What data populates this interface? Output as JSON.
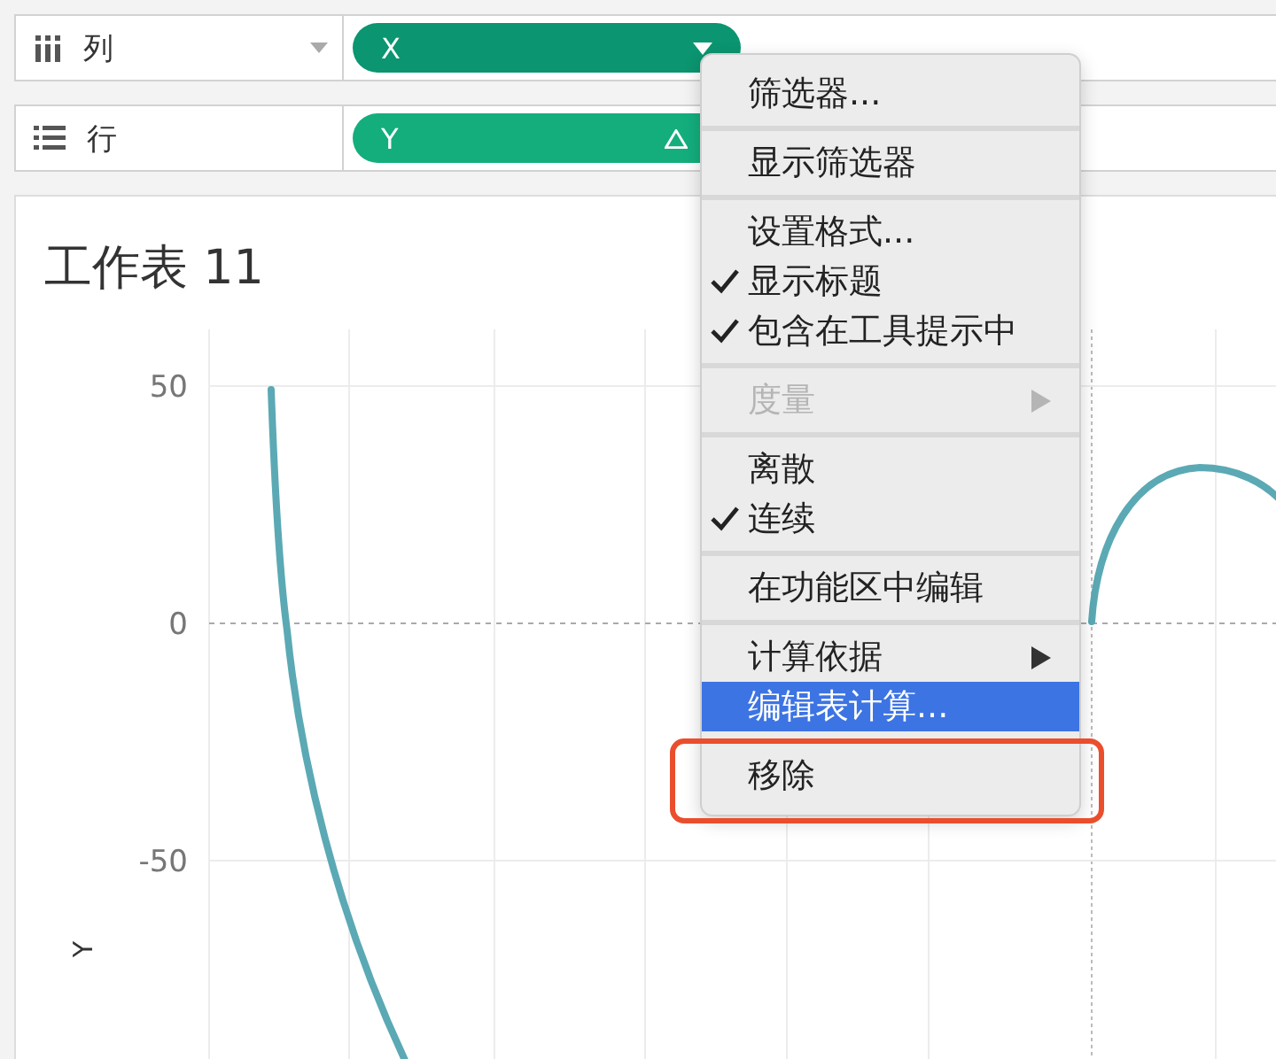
{
  "shelves": [
    {
      "kind": "columns",
      "label": "列",
      "pill": "X"
    },
    {
      "kind": "rows",
      "label": "行",
      "pill": "Y"
    }
  ],
  "sheet": {
    "title": "工作表 11",
    "y_axis": {
      "label": "Y",
      "ticks": [
        "50",
        "0",
        "-50"
      ]
    }
  },
  "context_menu": {
    "groups": [
      {
        "items": [
          {
            "label": "筛选器...",
            "checked": false,
            "disabled": false,
            "submenu": false,
            "selected": false
          }
        ]
      },
      {
        "items": [
          {
            "label": "显示筛选器",
            "checked": false,
            "disabled": false,
            "submenu": false,
            "selected": false
          }
        ]
      },
      {
        "items": [
          {
            "label": "设置格式...",
            "checked": false,
            "disabled": false,
            "submenu": false,
            "selected": false
          },
          {
            "label": "显示标题",
            "checked": true,
            "disabled": false,
            "submenu": false,
            "selected": false
          },
          {
            "label": "包含在工具提示中",
            "checked": true,
            "disabled": false,
            "submenu": false,
            "selected": false
          }
        ]
      },
      {
        "items": [
          {
            "label": "度量",
            "checked": false,
            "disabled": true,
            "submenu": true,
            "selected": false
          }
        ]
      },
      {
        "items": [
          {
            "label": "离散",
            "checked": false,
            "disabled": false,
            "submenu": false,
            "selected": false
          },
          {
            "label": "连续",
            "checked": true,
            "disabled": false,
            "submenu": false,
            "selected": false
          }
        ]
      },
      {
        "items": [
          {
            "label": "在功能区中编辑",
            "checked": false,
            "disabled": false,
            "submenu": false,
            "selected": false
          }
        ]
      },
      {
        "items": [
          {
            "label": "计算依据",
            "checked": false,
            "disabled": false,
            "submenu": true,
            "selected": false
          },
          {
            "label": "编辑表计算...",
            "checked": false,
            "disabled": false,
            "submenu": false,
            "selected": true
          }
        ]
      },
      {
        "items": [
          {
            "label": "移除",
            "checked": false,
            "disabled": false,
            "submenu": false,
            "selected": false
          }
        ]
      }
    ]
  }
}
